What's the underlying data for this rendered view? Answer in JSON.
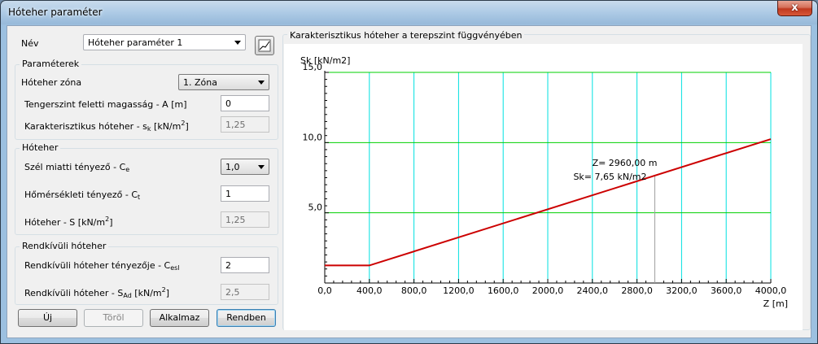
{
  "window": {
    "title": "Hóteher paraméter",
    "close_glyph": "x"
  },
  "name_row": {
    "label": "Név",
    "value": "Hóteher paraméter 1"
  },
  "parameters_group": {
    "title": "Paraméterek",
    "zone_label": "Hóteher zóna",
    "zone_value": "1. Zóna",
    "altitude_label": "Tengerszint feletti magasság - A [m]",
    "altitude_value": "0",
    "char_snow_label_main": "Karakterisztikus hóteher - s",
    "char_snow_label_sub": "k",
    "char_snow_label_unit": " [kN/m",
    "char_snow_label_sup": "2",
    "char_snow_label_end": "]",
    "char_snow_value": "1,25"
  },
  "snow_group": {
    "title": "Hóteher",
    "wind_label_main": "Szél miatti tényező - C",
    "wind_label_sub": "e",
    "wind_value": "1,0",
    "thermal_label_main": "Hőmérsékleti tényező - C",
    "thermal_label_sub": "t",
    "thermal_value": "1",
    "snow_label_main": "Hóteher - S [kN/m",
    "snow_label_sup": "2",
    "snow_label_end": "]",
    "snow_value": "1,25"
  },
  "exceptional_group": {
    "title": "Rendkívüli hóteher",
    "factor_label_main": "Rendkívüli hóteher tényezője - C",
    "factor_label_sub": "esl",
    "factor_value": "2",
    "load_label_main": "Rendkívüli hóteher - S",
    "load_label_sub": "Ad",
    "load_label_unit": " [kN/m",
    "load_label_sup": "2",
    "load_label_end": "]",
    "load_value": "2,5"
  },
  "buttons": {
    "new": "Új",
    "delete": "Töröl",
    "apply": "Alkalmaz",
    "ok": "Rendben"
  },
  "chart_panel": {
    "title": "Karakterisztikus hóteher a terepszint függvényében"
  },
  "icons": {
    "chart_toggle": "line-chart-icon",
    "combo_arrow": "chevron-down-icon"
  },
  "colors": {
    "grid_vertical": "#00e0e0",
    "grid_horizontal": "#00d000",
    "series": "#cc0000",
    "cursor_line": "#a0a0a0"
  },
  "chart_data": {
    "type": "line",
    "title": "Karakterisztikus hóteher a terepszint függvényében",
    "xlabel": "Z [m]",
    "ylabel": "Sk [kN/m2]",
    "xlim": [
      0,
      4000
    ],
    "ylim": [
      0,
      15
    ],
    "x_ticks": [
      "0,0",
      "400,0",
      "800,0",
      "1200,0",
      "1600,0",
      "2000,0",
      "2400,0",
      "2800,0",
      "3200,0",
      "3600,0",
      "4000,0"
    ],
    "y_ticks": [
      {
        "v": 5,
        "label": "5,0"
      },
      {
        "v": 10,
        "label": "10,0"
      },
      {
        "v": 15,
        "label": "15,0"
      }
    ],
    "grid": true,
    "series": [
      {
        "color": "#cc0000",
        "points": [
          [
            0,
            1.25
          ],
          [
            400,
            1.25
          ],
          [
            4000,
            10.25
          ]
        ]
      }
    ],
    "cursor": {
      "x": 2960,
      "y": 7.65,
      "label_z": "Z= 2960,00 m",
      "label_sk": "Sk= 7,65 kN/m2"
    }
  }
}
